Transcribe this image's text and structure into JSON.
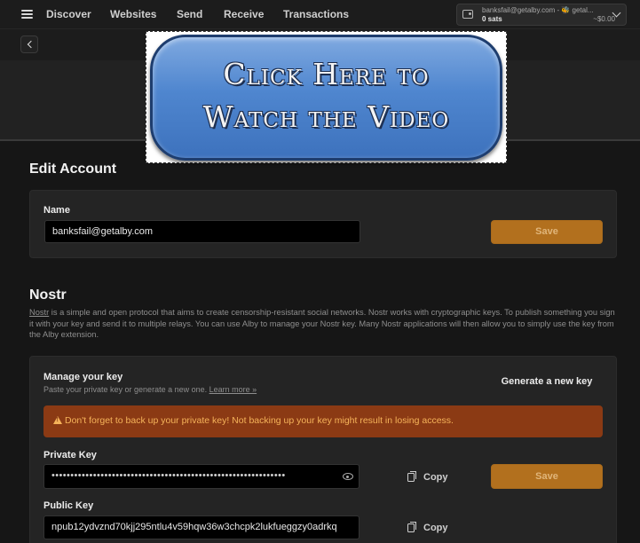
{
  "nav": {
    "items": [
      "Discover",
      "Websites",
      "Send",
      "Receive",
      "Transactions"
    ]
  },
  "account": {
    "email": "banksfail@getalby.com - 🐝 getal...",
    "balance_sats": "0 sats",
    "balance_usd": "~$0.00"
  },
  "video": {
    "line1": "Click Here to",
    "line2": "Watch the Video"
  },
  "edit_account": {
    "title": "Edit Account",
    "name_label": "Name",
    "name_value": "banksfail@getalby.com",
    "save_label": "Save"
  },
  "nostr": {
    "title": "Nostr",
    "link_text": "Nostr",
    "description": " is a simple and open protocol that aims to create censorship-resistant social networks. Nostr works with cryptographic keys. To publish something you sign it with your key and send it to multiple relays. You can use Alby to manage your Nostr key. Many Nostr applications will then allow you to simply use the key from the Alby extension.",
    "manage_title": "Manage your key",
    "manage_sub": "Paste your private key or generate a new one. ",
    "learn_more": "Learn more »",
    "generate_label": "Generate a new key",
    "warning": "Don't forget to back up your private key! Not backing up your key might result in losing access.",
    "private_key_label": "Private Key",
    "private_key_masked": "••••••••••••••••••••••••••••••••••••••••••••••••••••••••••••••",
    "public_key_label": "Public Key",
    "public_key_value": "npub12ydvznd70kjj295ntlu4v59hqw36w3chcpk2lukfueggzy0adrkq",
    "copy_label": "Copy",
    "save_label": "Save"
  }
}
